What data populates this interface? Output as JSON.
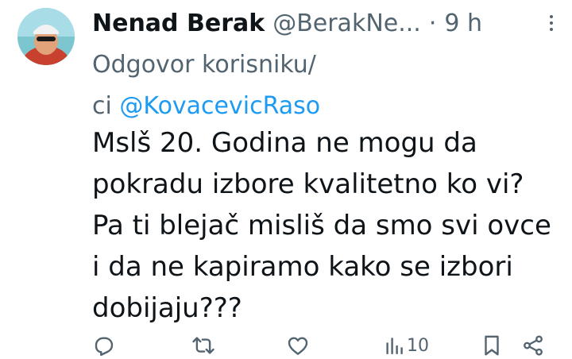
{
  "tweet": {
    "author_name": "Nenad Berak",
    "author_handle": "@BerakNe...",
    "separator": "·",
    "time": "9 h",
    "reply_prefix_line1": "Odgovor korisniku/",
    "reply_prefix_line2": "ci",
    "reply_mention": "@KovacevicRaso",
    "text_lines": [
      "Mslš 20. Godina ne mogu da",
      "pokradu izbore kvalitetno ko vi?",
      "Pa ti blejač misliš da smo svi ovce",
      "i da ne kapiramo kako se izbori",
      "dobijaju???"
    ]
  },
  "actions": {
    "views_count": "10"
  },
  "icons": {
    "more": "more-vertical-icon",
    "reply": "reply-icon",
    "retweet": "retweet-icon",
    "like": "heart-icon",
    "views": "analytics-icon",
    "bookmark": "bookmark-icon",
    "share": "share-icon"
  },
  "colors": {
    "text": "#0f1419",
    "secondary": "#536471",
    "link": "#1d9bf0"
  }
}
